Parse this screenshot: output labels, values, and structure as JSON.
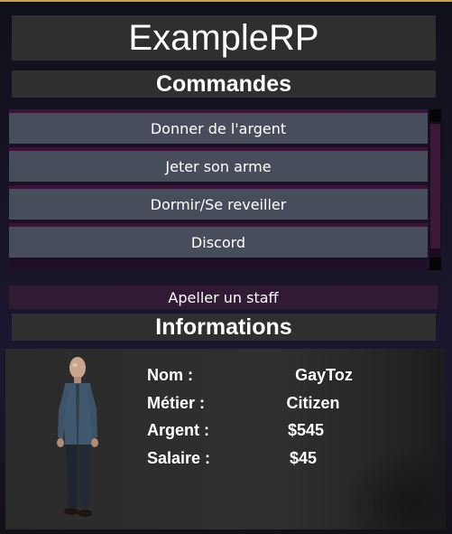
{
  "header": {
    "title": "ExampleRP"
  },
  "commands": {
    "section_title": "Commandes",
    "items": [
      {
        "label": "Donner de l'argent"
      },
      {
        "label": "Jeter son arme"
      },
      {
        "label": "Dormir/Se reveiller"
      },
      {
        "label": "Discord"
      }
    ]
  },
  "staff": {
    "label": "Apeller un staff"
  },
  "info": {
    "section_title": "Informations",
    "rows": [
      {
        "label": "Nom :",
        "value": "GayToz"
      },
      {
        "label": "Métier :",
        "value": "Citizen"
      },
      {
        "label": "Argent :",
        "value": "$545"
      },
      {
        "label": "Salaire :",
        "value": "$45"
      }
    ]
  },
  "colors": {
    "bar": "#2f2f2f",
    "button": "#474d5a",
    "accent_purple": "#3a1438",
    "staff_button": "#301a34"
  },
  "icons": {
    "avatar": "player-model-avatar"
  }
}
